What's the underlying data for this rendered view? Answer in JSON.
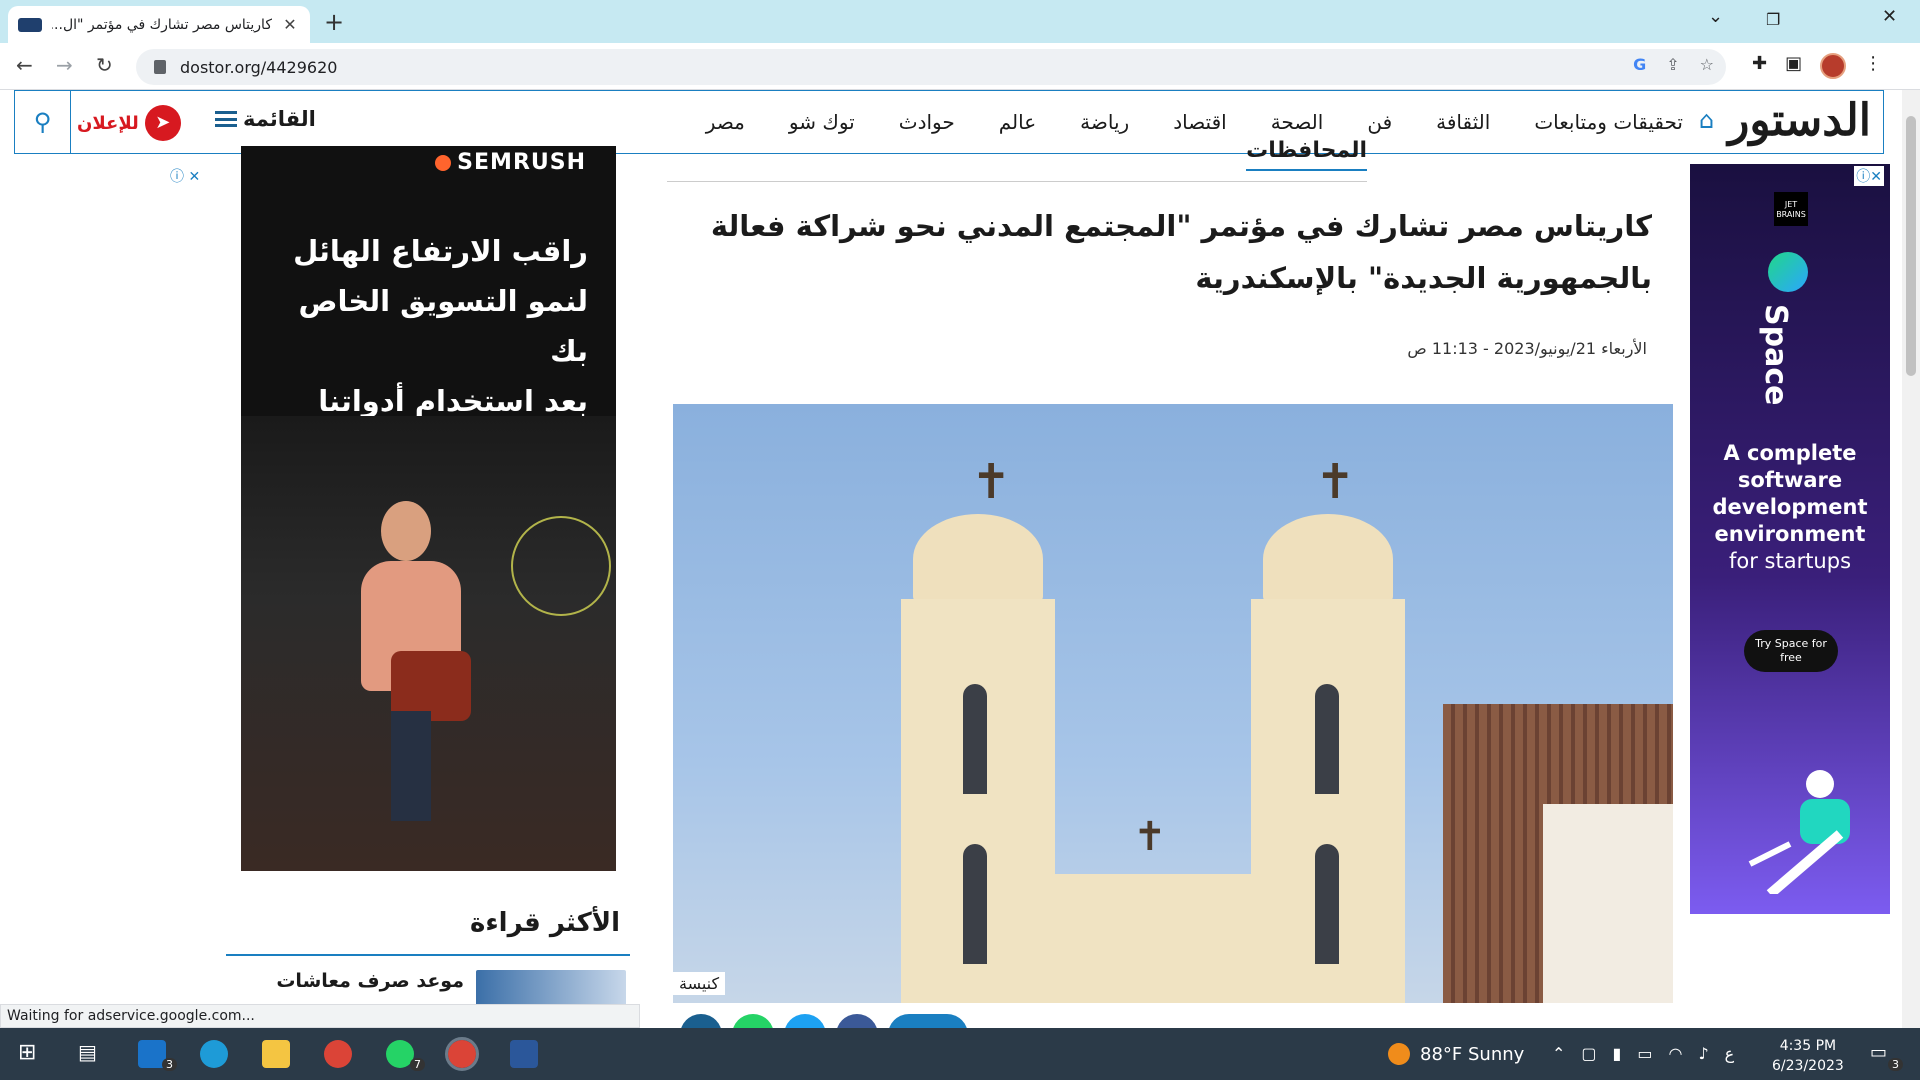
{
  "browser": {
    "tab_title": "كاريتاس مصر تشارك في مؤتمر \"ال...",
    "tab_close": "✕",
    "new_tab": "+",
    "url": "dostor.org/4429620",
    "controls": {
      "minimize": "⌄",
      "restore": "❐",
      "close": "✕"
    },
    "nav": {
      "back": "←",
      "forward": "→",
      "reload": "↻"
    }
  },
  "site": {
    "logo": "الدستور",
    "nav_items": [
      "مصر",
      "توك شو",
      "حوادث",
      "عالم",
      "رياضة",
      "اقتصاد",
      "الصحة",
      "فن",
      "الثقافة",
      "تحقيقات ومتابعات"
    ],
    "menu_label": "القائمة",
    "advertise_label": "للإعلان"
  },
  "article": {
    "section": "المحافظات",
    "headline": "كاريتاس مصر تشارك في مؤتمر \"المجتمع المدني نحو شراكة فعالة بالجمهورية الجديدة\" بالإسكندرية",
    "date": "الأربعاء 21/يونيو/2023 - 11:13 ص",
    "image_caption": "كنيسة"
  },
  "ad_left": {
    "brand": "SEMRUSH",
    "copy": "راقب الارتفاع الهائل\nلنمو التسويق الخاص بك\nبعد استخدام أدواتنا"
  },
  "most_read": {
    "heading": "الأكثر قراءة",
    "item_title": "موعد صرف معاشات"
  },
  "ad_right": {
    "jetbrains": "JET BRAINS",
    "product": "Space",
    "copy_line1": "A complete",
    "copy_line2": "software",
    "copy_line3": "development",
    "copy_line4": "environment",
    "copy_line5": "for startups",
    "cta": "Try Space for free"
  },
  "status_text": "Waiting for adservice.google.com...",
  "taskbar": {
    "weather": "88°F  Sunny",
    "time": "4:35 PM",
    "date": "6/23/2023",
    "mail_badge": "3",
    "whatsapp_badge": "7",
    "notif_badge": "3",
    "lang": "ع"
  }
}
